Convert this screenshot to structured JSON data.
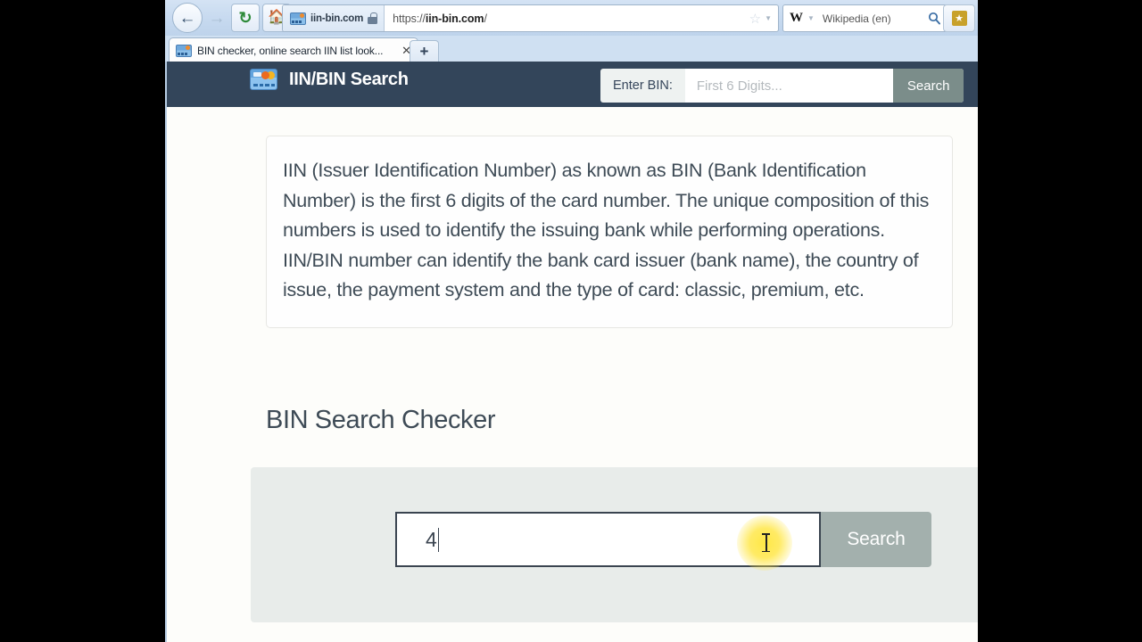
{
  "browser": {
    "nav": {
      "back_icon": "back-arrow-icon",
      "forward_icon": "forward-arrow-icon",
      "reload_icon": "reload-icon",
      "home_icon": "home-icon"
    },
    "identity_label": "iin-bin.com",
    "lock_icon": "padlock-icon",
    "url_prefix": "https://",
    "url_domain": "iin-bin.com",
    "url_path": "/",
    "bookmark_star_icon": "star-icon",
    "search_engine": {
      "glyph": "W",
      "name": "Wikipedia (en)",
      "magnifier_icon": "magnifier-icon"
    },
    "bookmarks_button_icon": "bookmarks-star-icon",
    "tab": {
      "favicon": "credit-card-favicon",
      "title": "BIN checker, online search IIN list look...",
      "close_icon": "close-icon"
    },
    "new_tab_label": "+"
  },
  "site": {
    "logo_icon": "credit-card-logo-icon",
    "title": "IIN/BIN Search",
    "header_search": {
      "label": "Enter BIN:",
      "placeholder": "First 6 Digits...",
      "value": "",
      "button_label": "Search"
    }
  },
  "main": {
    "intro_text": "IIN (Issuer Identification Number) as known as BIN (Bank Identification Number) is the first 6 digits of the card number. The unique composition of this numbers is used to identify the issuing bank while performing operations. IIN/BIN number can identify the bank card issuer (bank name), the country of issue, the payment system and the type of card: classic, premium, etc.",
    "section_title": "BIN Search Checker",
    "search": {
      "value": "4",
      "placeholder": "",
      "button_label": "Search"
    }
  },
  "colors": {
    "header_bg": "#33455a",
    "panel_bg": "#e8ecea",
    "button_bg": "#a3b0ad",
    "header_button_bg": "#7b8d8a",
    "text": "#3e4b56",
    "page_bg": "#fdfdfa",
    "click_highlight": "#ffe63c"
  }
}
